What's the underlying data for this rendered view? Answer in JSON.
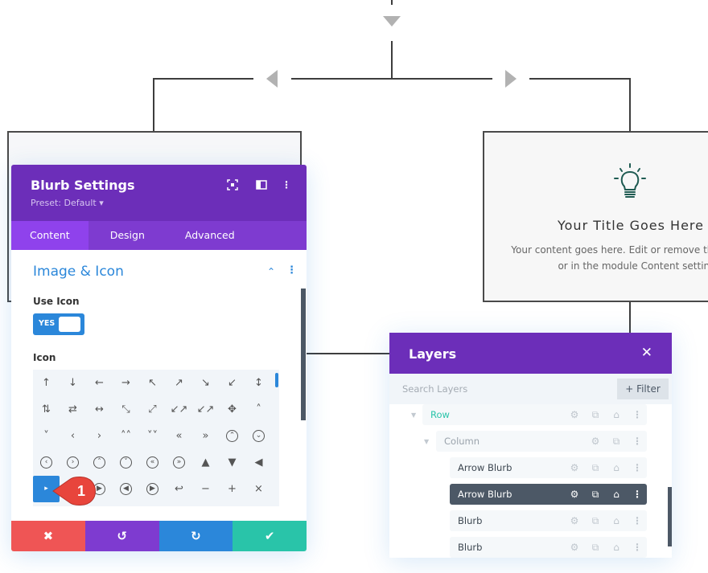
{
  "diagram": {
    "arrows": [
      "triangle-down",
      "triangle-left",
      "triangle-right"
    ]
  },
  "preview_card": {
    "icon": "lightbulb-icon",
    "title": "Your Title Goes Here",
    "text_line1": "Your content goes here. Edit or remove this",
    "text_line2": "or in the module Content settings"
  },
  "blurb_settings": {
    "title": "Blurb Settings",
    "preset": "Preset: Default ▾",
    "header_icons": [
      "fullscreen-icon",
      "sidebar-layout-icon",
      "more-options-icon"
    ],
    "tabs": [
      {
        "label": "Content",
        "active": true
      },
      {
        "label": "Design",
        "active": false
      },
      {
        "label": "Advanced",
        "active": false
      }
    ],
    "section_title": "Image & Icon",
    "use_icon_label": "Use Icon",
    "use_icon_toggle": "YES",
    "icon_label": "Icon",
    "icon_grid": [
      [
        "↑",
        "↓",
        "←",
        "→",
        "↖",
        "↗",
        "↘",
        "↙",
        "↕"
      ],
      [
        "⇅",
        "⇄",
        "↔",
        "⤡",
        "⤢",
        "↙↗",
        "↙↗",
        "✥",
        "˄"
      ],
      [
        "˅",
        "‹",
        "›",
        "˄˄",
        "˅˅",
        "«",
        "»",
        "⌃",
        "⌄"
      ],
      [
        "‹",
        "›",
        "˄",
        "˅",
        "«",
        "»",
        "▲",
        "▼",
        "◀"
      ],
      [
        "▶",
        "◀",
        "▶",
        "◀",
        "▶",
        "↩",
        "−",
        "+",
        "×"
      ]
    ],
    "selected_icon": "▸",
    "badge_number": "1",
    "actions": [
      {
        "name": "cancel",
        "glyph": "✖",
        "color": "#ef5555"
      },
      {
        "name": "undo",
        "glyph": "↺",
        "color": "#7e3bd0"
      },
      {
        "name": "redo",
        "glyph": "↻",
        "color": "#2b87da"
      },
      {
        "name": "save",
        "glyph": "✔",
        "color": "#29c4a9"
      }
    ]
  },
  "layers": {
    "title": "Layers",
    "close": "✕",
    "search_placeholder": "Search Layers",
    "filter_label": "+ Filter",
    "items": [
      {
        "label": "Row",
        "type": "row",
        "color": "#29c4a9"
      },
      {
        "label": "Column",
        "type": "column"
      },
      {
        "label": "Arrow Blurb",
        "type": "module"
      },
      {
        "label": "Arrow Blurb",
        "type": "module",
        "selected": true
      },
      {
        "label": "Blurb",
        "type": "module"
      },
      {
        "label": "Blurb",
        "type": "module"
      }
    ],
    "row_icons": {
      "settings": "⚙",
      "duplicate": "⧉",
      "delete": "⌂",
      "more": "⋮"
    }
  }
}
